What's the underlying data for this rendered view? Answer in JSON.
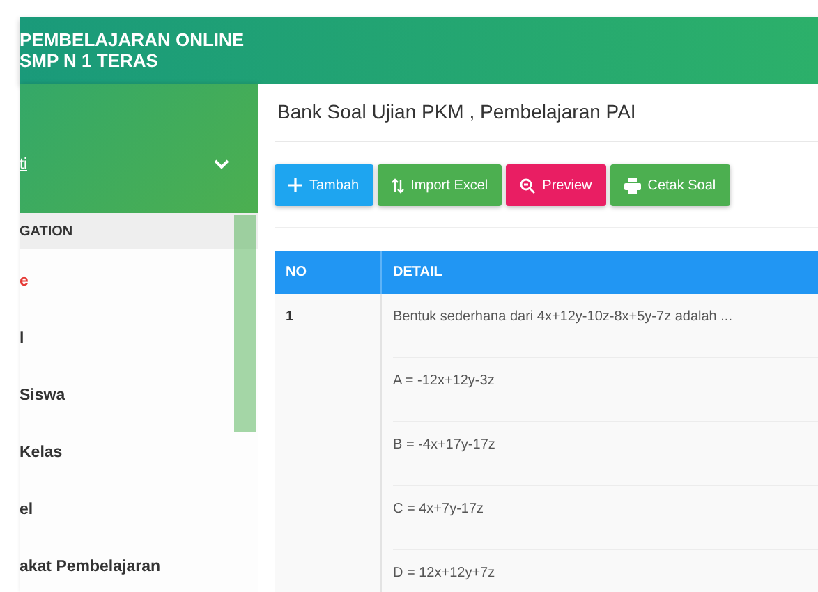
{
  "header": {
    "title_lines": [
      "PEMBELAJARAN ONLINE",
      "SMP N 1 TERAS"
    ]
  },
  "user_panel": {
    "link": "ti"
  },
  "sidebar": {
    "heading": "GATION",
    "items": [
      {
        "label": "e",
        "selected": true
      },
      {
        "label": "l",
        "selected": false
      },
      {
        "label": "Siswa",
        "selected": false
      },
      {
        "label": "Kelas",
        "selected": false
      },
      {
        "label": "el",
        "selected": false
      },
      {
        "label": "akat Pembelajaran",
        "selected": false
      }
    ]
  },
  "page_title": "Bank Soal Ujian PKM , Pembelajaran PAI",
  "buttons": [
    {
      "kind": "add",
      "label": "Tambah"
    },
    {
      "kind": "import",
      "label": "Import Excel"
    },
    {
      "kind": "preview",
      "label": "Preview"
    },
    {
      "kind": "print",
      "label": "Cetak Soal"
    }
  ],
  "table": {
    "columns": [
      "NO",
      "DETAIL"
    ],
    "rows": [
      {
        "no": "1",
        "question": "Bentuk sederhana dari 4x+12y-10z-8x+5y-7z adalah ...",
        "options": [
          "A = -12x+12y-3z",
          "B = -4x+17y-17z",
          "C = 4x+7y-17z",
          "D = 12x+12y+7z"
        ]
      }
    ]
  }
}
